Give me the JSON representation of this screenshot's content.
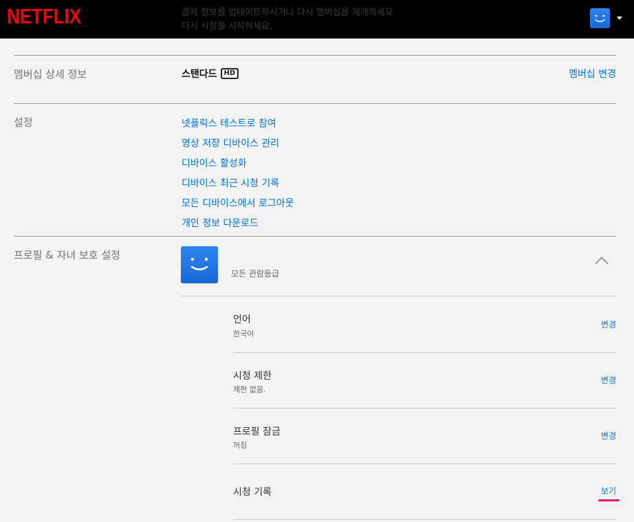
{
  "header": {
    "brand": "NETFLIX",
    "brand_color": "#e50914",
    "notice_line1": "결제 정보를 업데이트하시거나 다시 멤버십을 재개하세요",
    "notice_line2": "다시 시청을 시작하세요.",
    "avatar_icon": "smile-face-icon",
    "menu_icon": "caret-down-icon"
  },
  "membership": {
    "label": "멤버십 상세 정보",
    "plan": "스탠다드",
    "plan_badge": "HD",
    "change_link": "멤버십 변경"
  },
  "settings": {
    "label": "설정",
    "links": [
      "넷플릭스 테스트로 참여",
      "영상 저장 디바이스 관리",
      "디바이스 활성화",
      "디바이스 최근 시청 기록",
      "모든 디바이스에서 로그아웃",
      "개인 정보 다운로드"
    ]
  },
  "profile": {
    "label": "프로필 & 자녀 보호 설정",
    "maturity": "모든 관람등급",
    "collapse_icon": "chevron-up-icon",
    "rows": [
      {
        "title": "언어",
        "value": "한국어",
        "action": "변경"
      },
      {
        "title": "시청 제한",
        "value": "제한 없음.",
        "action": "변경"
      },
      {
        "title": "프로필 잠금",
        "value": "꺼짐",
        "action": "변경"
      },
      {
        "title": "시청 기록",
        "value": "",
        "action": "보기"
      }
    ]
  },
  "colors": {
    "link": "#0073e6",
    "highlight_underline": "#e5196e"
  }
}
